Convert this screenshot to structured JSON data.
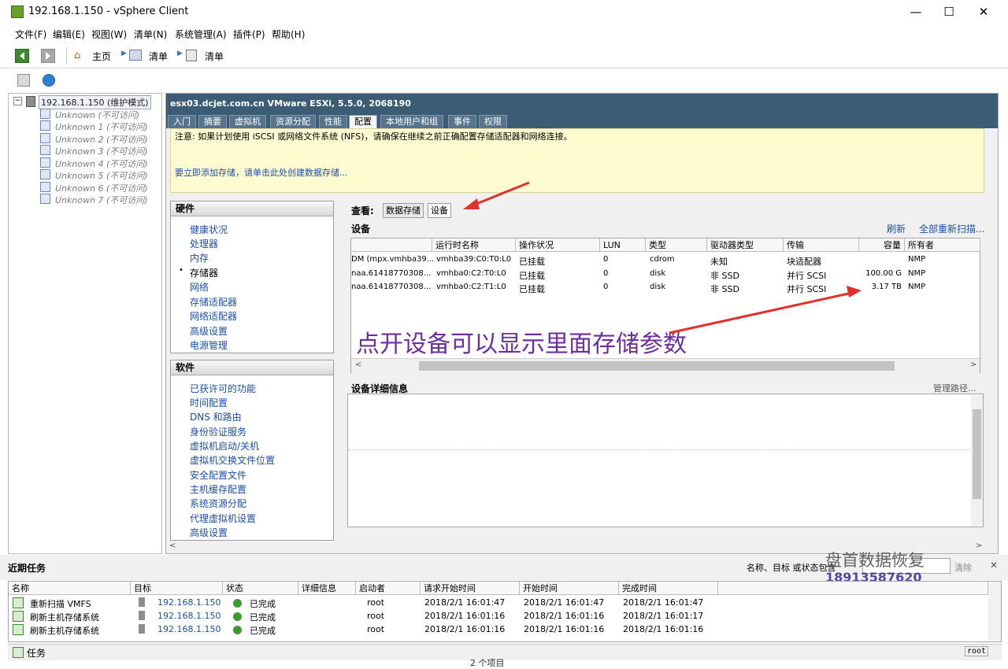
{
  "window": {
    "title": "192.168.1.150 - vSphere Client",
    "minimize": "—",
    "maximize": "☐",
    "close": "✕"
  },
  "menu": [
    "文件(F)",
    "编辑(E)",
    "视图(W)",
    "清单(N)",
    "系统管理(A)",
    "插件(P)",
    "帮助(H)"
  ],
  "toolbar": {
    "home": "主页",
    "inventory1": "清单",
    "inventory2": "清单"
  },
  "tree": {
    "host": "192.168.1.150 (维护模式)",
    "vms": [
      "Unknown (不可访问)",
      "Unknown 1 (不可访问)",
      "Unknown 2 (不可访问)",
      "Unknown 3 (不可访问)",
      "Unknown 4 (不可访问)",
      "Unknown 5 (不可访问)",
      "Unknown 6 (不可访问)",
      "Unknown 7 (不可访问)"
    ]
  },
  "host_header": "esx03.dcjet.com.cn VMware ESXi, 5.5.0, 2068190",
  "tabs": [
    "入门",
    "摘要",
    "虚拟机",
    "资源分配",
    "性能",
    "配置",
    "本地用户和组",
    "事件",
    "权限"
  ],
  "notice": {
    "text": "注意: 如果计划使用 iSCSI 或网络文件系统 (NFS)，请确保在继续之前正确配置存储适配器和网络连接。",
    "link": "要立即添加存储，请单击此处创建数据存储..."
  },
  "hardware": {
    "title": "硬件",
    "items": [
      "健康状况",
      "处理器",
      "内存",
      "存储器",
      "网络",
      "存储适配器",
      "网络适配器",
      "高级设置",
      "电源管理"
    ],
    "selected": "存储器",
    "bullet": "•"
  },
  "software": {
    "title": "软件",
    "items": [
      "已获许可的功能",
      "时间配置",
      "DNS 和路由",
      "身份验证服务",
      "虚拟机启动/关机",
      "虚拟机交换文件位置",
      "安全配置文件",
      "主机缓存配置",
      "系统资源分配",
      "代理虚拟机设置",
      "高级设置"
    ]
  },
  "view": {
    "label": "查看:",
    "datastores": "数据存储",
    "devices": "设备"
  },
  "devices": {
    "title": "设备",
    "refresh": "刷新",
    "rescan": "全部重新扫描...",
    "columns": [
      "",
      "运行时名称",
      "操作状况",
      "LUN",
      "类型",
      "驱动器类型",
      "传输",
      "容量",
      "所有者"
    ],
    "rows": [
      [
        "DM (mpx.vmhba39...",
        "vmhba39:C0:T0:L0",
        "已挂载",
        "0",
        "cdrom",
        "未知",
        "块适配器",
        "",
        "NMP"
      ],
      [
        "naa.61418770308...",
        "vmhba0:C2:T0:L0",
        "已挂载",
        "0",
        "disk",
        "非 SSD",
        "并行 SCSI",
        "100.00 G",
        "NMP"
      ],
      [
        "naa.61418770308...",
        "vmhba0:C2:T1:L0",
        "已挂载",
        "0",
        "disk",
        "非 SSD",
        "并行 SCSI",
        "3.17 TB",
        "NMP"
      ]
    ]
  },
  "annotation": "点开设备可以显示里面存储参数",
  "detail": {
    "title": "设备详细信息",
    "manage_paths": "管理路径..."
  },
  "tasks": {
    "title": "近期任务",
    "filter_label": "名称、目标 或状态包含",
    "clear": "清除",
    "close": "✕",
    "columns": [
      "名称",
      "目标",
      "状态",
      "详细信息",
      "启动者",
      "请求开始时间",
      "开始时间",
      "完成时间"
    ],
    "rows": [
      [
        "重新扫描 VMFS",
        "192.168.1.150",
        "已完成",
        "",
        "root",
        "2018/2/1 16:01:47",
        "2018/2/1 16:01:47",
        "2018/2/1 16:01:47"
      ],
      [
        "刷新主机存储系统",
        "192.168.1.150",
        "已完成",
        "",
        "root",
        "2018/2/1 16:01:16",
        "2018/2/1 16:01:16",
        "2018/2/1 16:01:17"
      ],
      [
        "刷新主机存储系统",
        "192.168.1.150",
        "已完成",
        "",
        "root",
        "2018/2/1 16:01:16",
        "2018/2/1 16:01:16",
        "2018/2/1 16:01:16"
      ]
    ]
  },
  "watermark": {
    "name": "盘首数据恢复",
    "phone": "18913587620"
  },
  "status": {
    "tasks": "任务",
    "user": "root",
    "items": "2 个项目"
  },
  "colors": {
    "accent": "#1b4fa8",
    "annotation": "#6c2ea0",
    "arrow": "#e0322a",
    "header": "#3c5c76",
    "notice": "#fffbd1"
  }
}
